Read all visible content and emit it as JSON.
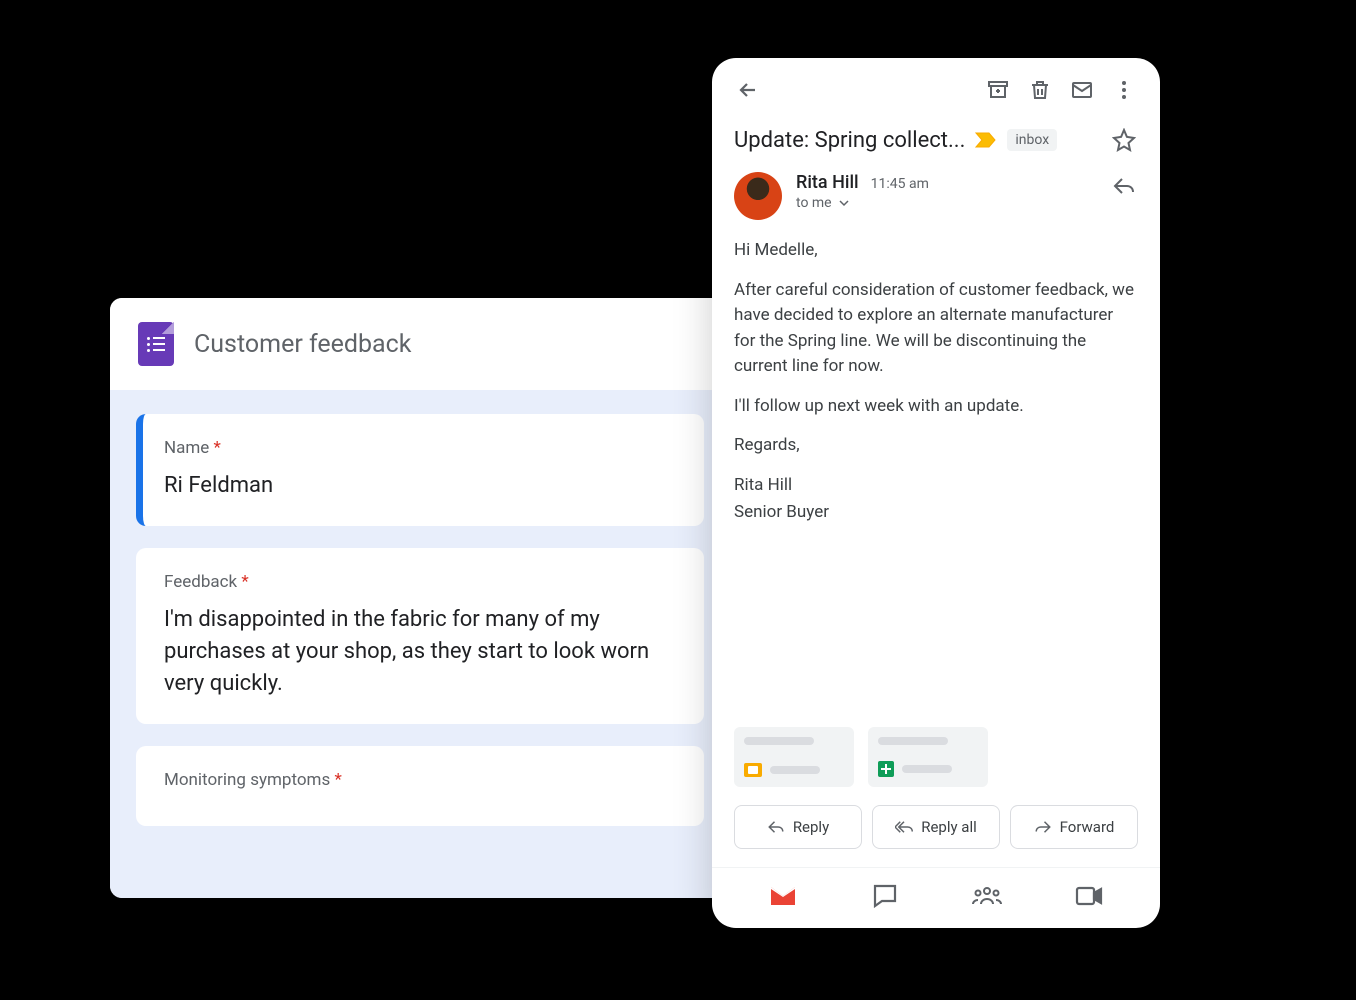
{
  "forms": {
    "title": "Customer feedback",
    "questions": [
      {
        "label": "Name",
        "required": true,
        "value": "Ri Feldman",
        "active": true
      },
      {
        "label": "Feedback",
        "required": true,
        "value": "I'm disappointed in the fabric for many of my purchases at your shop, as they start to look worn very quickly.",
        "active": false
      },
      {
        "label": "Monitoring symptoms",
        "required": true,
        "value": "",
        "active": false
      }
    ]
  },
  "gmail": {
    "subject": "Update: Spring collect...",
    "inbox_label": "inbox",
    "sender": {
      "name": "Rita Hill",
      "time": "11:45 am",
      "to": "to me"
    },
    "body": {
      "greeting": "Hi Medelle,",
      "p1": "After careful consideration of customer feedback, we have decided to explore an alternate manufacturer for the Spring line. We will be discontinuing the current line for now.",
      "p2": "I'll follow up next week with an update.",
      "closing": "Regards,",
      "sig_name": "Rita Hill",
      "sig_title": "Senior Buyer"
    },
    "buttons": {
      "reply": "Reply",
      "reply_all": "Reply all",
      "forward": "Forward"
    }
  }
}
